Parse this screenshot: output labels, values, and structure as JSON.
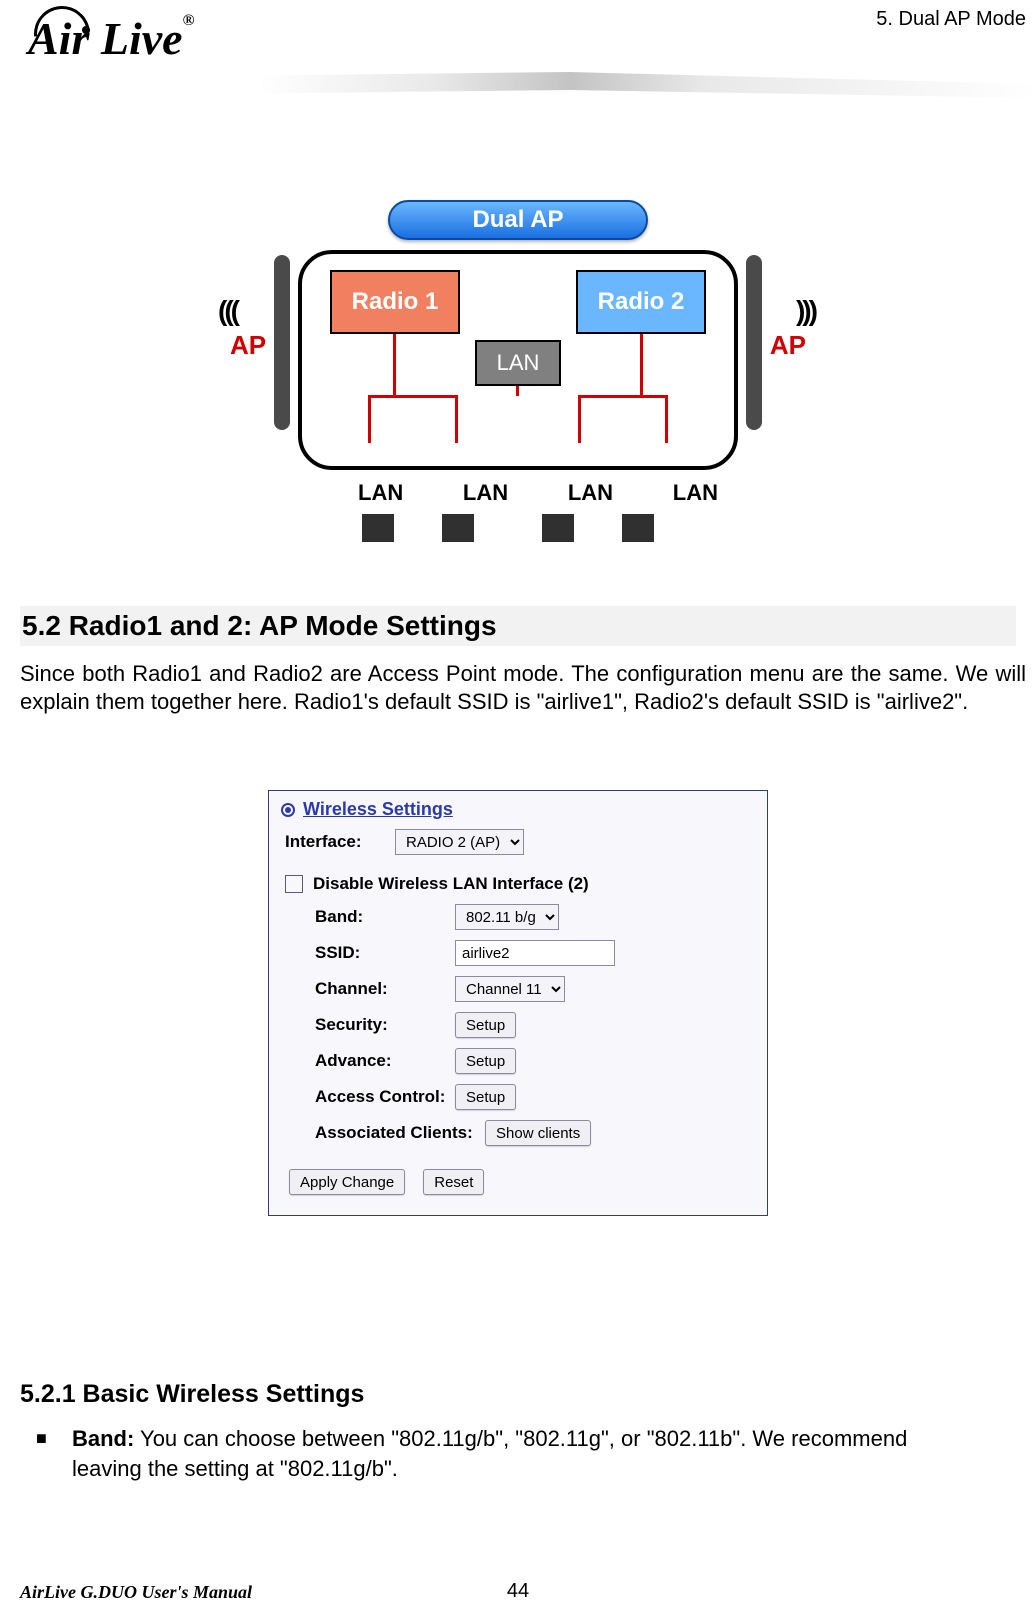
{
  "header": {
    "chapter": "5.  Dual AP Mode",
    "logo_text": "Air Live",
    "reg": "®"
  },
  "fig1": {
    "title": "Dual AP",
    "radio1": "Radio 1",
    "radio2": "Radio 2",
    "lan": "LAN",
    "ap": "AP",
    "ports": [
      "LAN",
      "LAN",
      "LAN",
      "LAN"
    ]
  },
  "section": {
    "heading": "5.2 Radio1  and  2:  AP  Mode  Settings",
    "para": "Since both Radio1 and Radio2 are Access Point mode.   The configuration menu are the same.   We will explain them together here.   Radio1's default SSID is \"airlive1\", Radio2's default SSID is \"airlive2\"."
  },
  "fig2": {
    "panel_title": "Wireless Settings",
    "interface_label": "Interface:",
    "interface_value": "RADIO 2 (AP)",
    "disable_label": "Disable Wireless LAN Interface (2)",
    "rows": {
      "band_label": "Band:",
      "band_value": "802.11 b/g",
      "ssid_label": "SSID:",
      "ssid_value": "airlive2",
      "channel_label": "Channel:",
      "channel_value": "Channel 11",
      "security_label": "Security:",
      "security_btn": "Setup",
      "advance_label": "Advance:",
      "advance_btn": "Setup",
      "access_label": "Access Control:",
      "access_btn": "Setup",
      "clients_label": "Associated Clients:",
      "clients_btn": "Show clients"
    },
    "apply_btn": "Apply Change",
    "reset_btn": "Reset"
  },
  "sub": {
    "heading": "5.2.1 Basic Wireless Settings",
    "band_label": "Band:",
    "band_text": "   You can choose between \"802.11g/b\", \"802.11g\", or \"802.11b\".   We recommend leaving the setting at \"802.11g/b\"."
  },
  "footer": {
    "manual": "AirLive G.DUO User's Manual",
    "page": "44"
  }
}
